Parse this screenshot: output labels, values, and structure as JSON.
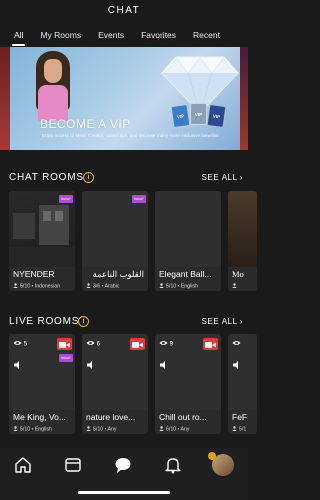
{
  "header": {
    "title": "CHAT"
  },
  "tabs": [
    {
      "label": "All",
      "active": true
    },
    {
      "label": "My Rooms",
      "active": false
    },
    {
      "label": "Events",
      "active": false
    },
    {
      "label": "Favorites",
      "active": false
    },
    {
      "label": "Recent",
      "active": false
    }
  ],
  "banner": {
    "headline": "BECOME A VIP",
    "description": "Enjoy access to Mesh Creator, collect tips, and discover many more exclusive benefits!",
    "card_labels": [
      "VIP",
      "VIP",
      "VIP"
    ]
  },
  "chat_rooms": {
    "title": "CHAT ROOMS",
    "see_all": "SEE ALL",
    "items": [
      {
        "name": "NYENDER",
        "occupancy": "5/10",
        "language": "Indonesian",
        "badge": "Imvu+"
      },
      {
        "name": "القلوب الناعمة",
        "occupancy": "3/6",
        "language": "Arabic",
        "badge": "Imvu+"
      },
      {
        "name": "Elegant Ball...",
        "occupancy": "5/10",
        "language": "English",
        "badge": ""
      },
      {
        "name": "Mo",
        "occupancy": "",
        "language": "",
        "badge": ""
      }
    ]
  },
  "live_rooms": {
    "title": "LIVE ROOMS",
    "see_all": "SEE ALL",
    "items": [
      {
        "name": "Me King, Vo...",
        "viewers": "5",
        "occupancy": "5/10",
        "language": "English",
        "badge": "Imvu+"
      },
      {
        "name": "nature love...",
        "viewers": "6",
        "occupancy": "5/10",
        "language": "Any",
        "badge": ""
      },
      {
        "name": "Chill out ro...",
        "viewers": "9",
        "occupancy": "6/10",
        "language": "Any",
        "badge": ""
      },
      {
        "name": "FeF",
        "viewers": "",
        "occupancy": "5/1",
        "language": "",
        "badge": ""
      }
    ]
  },
  "nav": [
    {
      "icon": "home-icon"
    },
    {
      "icon": "shop-icon"
    },
    {
      "icon": "chat-icon",
      "active": true
    },
    {
      "icon": "bell-icon"
    },
    {
      "icon": "profile-avatar"
    }
  ],
  "colors": {
    "accent": "#e2b13c",
    "live_red": "#e03a3a",
    "badge_purple": "#b14ad6"
  }
}
